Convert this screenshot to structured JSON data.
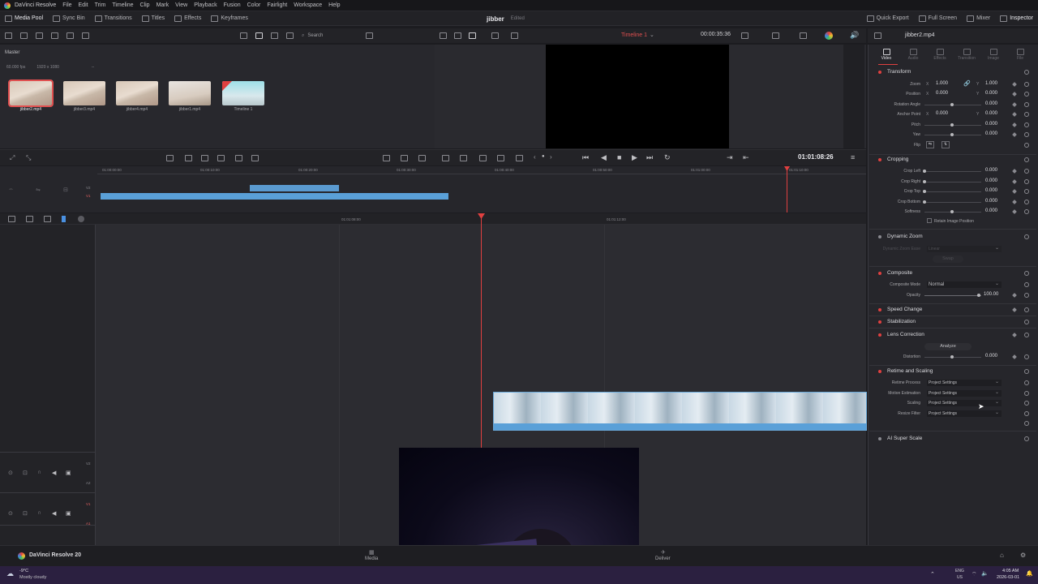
{
  "app": {
    "title": "DaVinci Resolve"
  },
  "menu": [
    "File",
    "Edit",
    "Trim",
    "Timeline",
    "Clip",
    "Mark",
    "View",
    "Playback",
    "Fusion",
    "Color",
    "Fairlight",
    "Workspace",
    "Help"
  ],
  "toolbar_left": [
    {
      "label": "Media Pool",
      "icon": "media-pool-icon",
      "active": true
    },
    {
      "label": "Sync Bin",
      "icon": "sync-bin-icon",
      "active": false
    },
    {
      "label": "Transitions",
      "icon": "transitions-icon",
      "active": false
    },
    {
      "label": "Titles",
      "icon": "titles-icon",
      "active": false
    },
    {
      "label": "Effects",
      "icon": "effects-icon",
      "active": false
    },
    {
      "label": "Keyframes",
      "icon": "keyframes-icon",
      "active": false
    }
  ],
  "project": {
    "name": "jibber",
    "status": "Edited"
  },
  "toolbar_right": [
    {
      "label": "Quick Export",
      "icon": "export-icon"
    },
    {
      "label": "Full Screen",
      "icon": "fullscreen-icon"
    },
    {
      "label": "Mixer",
      "icon": "mixer-icon"
    },
    {
      "label": "Inspector",
      "icon": "inspector-icon"
    }
  ],
  "media_pool": {
    "search_placeholder": "Search",
    "bin": "Master",
    "fps": "60.000 fps",
    "resolution": "1920 x 1080",
    "extra": "--",
    "clips": [
      {
        "name": "jibber2.mp4",
        "selected": true
      },
      {
        "name": "jibber3.mp4",
        "selected": false
      },
      {
        "name": "jibber4.mp4",
        "selected": false
      },
      {
        "name": "jibber1.mp4",
        "selected": false
      },
      {
        "name": "Timeline 1",
        "selected": false
      }
    ]
  },
  "viewer": {
    "timeline": "Timeline 1",
    "duration": "00:00:35:36",
    "timecode": "01:01:08:26"
  },
  "mini_timeline": {
    "ticks": [
      "01:00:00:00",
      "01:00:10:00",
      "01:00:20:00",
      "01:00:30:00",
      "01:00:40:00",
      "01:00:50:00",
      "01:01:00:00",
      "01:01:10:00"
    ],
    "tracks": [
      "V2",
      "V1"
    ]
  },
  "timeline": {
    "ticks": [
      "01:01:08:00",
      "01:01:12:00"
    ],
    "tracks": [
      {
        "label": "V2"
      },
      {
        "label": "A2"
      },
      {
        "label": "V1"
      },
      {
        "label": "A1"
      }
    ]
  },
  "inspector": {
    "clip": "jibber2.mp4",
    "tabs": [
      "Video",
      "Audio",
      "Effects",
      "Transition",
      "Image",
      "File"
    ],
    "transform": {
      "title": "Transform",
      "zoom_label": "Zoom",
      "zoom_x": "1.000",
      "zoom_y": "1.000",
      "position_label": "Position",
      "position_x": "0.000",
      "position_y": "0.000",
      "rotation_label": "Rotation Angle",
      "rotation": "0.000",
      "anchor_label": "Anchor Point",
      "anchor_x": "0.000",
      "anchor_y": "0.000",
      "pitch_label": "Pitch",
      "pitch": "0.000",
      "yaw_label": "Yaw",
      "yaw": "0.000",
      "flip_label": "Flip",
      "axis_x": "X",
      "axis_y": "Y"
    },
    "cropping": {
      "title": "Cropping",
      "left_label": "Crop Left",
      "left": "0.000",
      "right_label": "Crop Right",
      "right": "0.000",
      "top_label": "Crop Top",
      "top": "0.000",
      "bottom_label": "Crop Bottom",
      "bottom": "0.000",
      "softness_label": "Softness",
      "softness": "0.000",
      "retain_label": "Retain Image Position"
    },
    "dynamic_zoom": {
      "title": "Dynamic Zoom",
      "ease_label": "Dynamic Zoom Ease",
      "ease": "Linear",
      "swap": "Swap"
    },
    "composite": {
      "title": "Composite",
      "mode_label": "Composite Mode",
      "mode": "Normal",
      "opacity_label": "Opacity",
      "opacity": "100.00"
    },
    "speed_change": {
      "title": "Speed Change"
    },
    "stabilization": {
      "title": "Stabilization"
    },
    "lens_correction": {
      "title": "Lens Correction",
      "analyze": "Analyze",
      "distortion_label": "Distortion",
      "distortion": "0.000"
    },
    "retime": {
      "title": "Retime and Scaling",
      "process_label": "Retime Process",
      "process": "Project Settings",
      "motion_label": "Motion Estimation",
      "motion": "Project Settings",
      "scaling_label": "Scaling",
      "scaling": "Project Settings",
      "resize_label": "Resize Filter",
      "resize": "Project Settings"
    },
    "ai_super_scale": {
      "title": "AI Super Scale"
    }
  },
  "bottom": {
    "brand": "DaVinci Resolve 20",
    "page_media": "Media",
    "page_deliver": "Deliver"
  },
  "taskbar": {
    "temp": "-9°C",
    "weather": "Mostly cloudy",
    "lang": "ENG",
    "region": "US",
    "time": "4:05 AM",
    "date": "2026-03-01"
  }
}
